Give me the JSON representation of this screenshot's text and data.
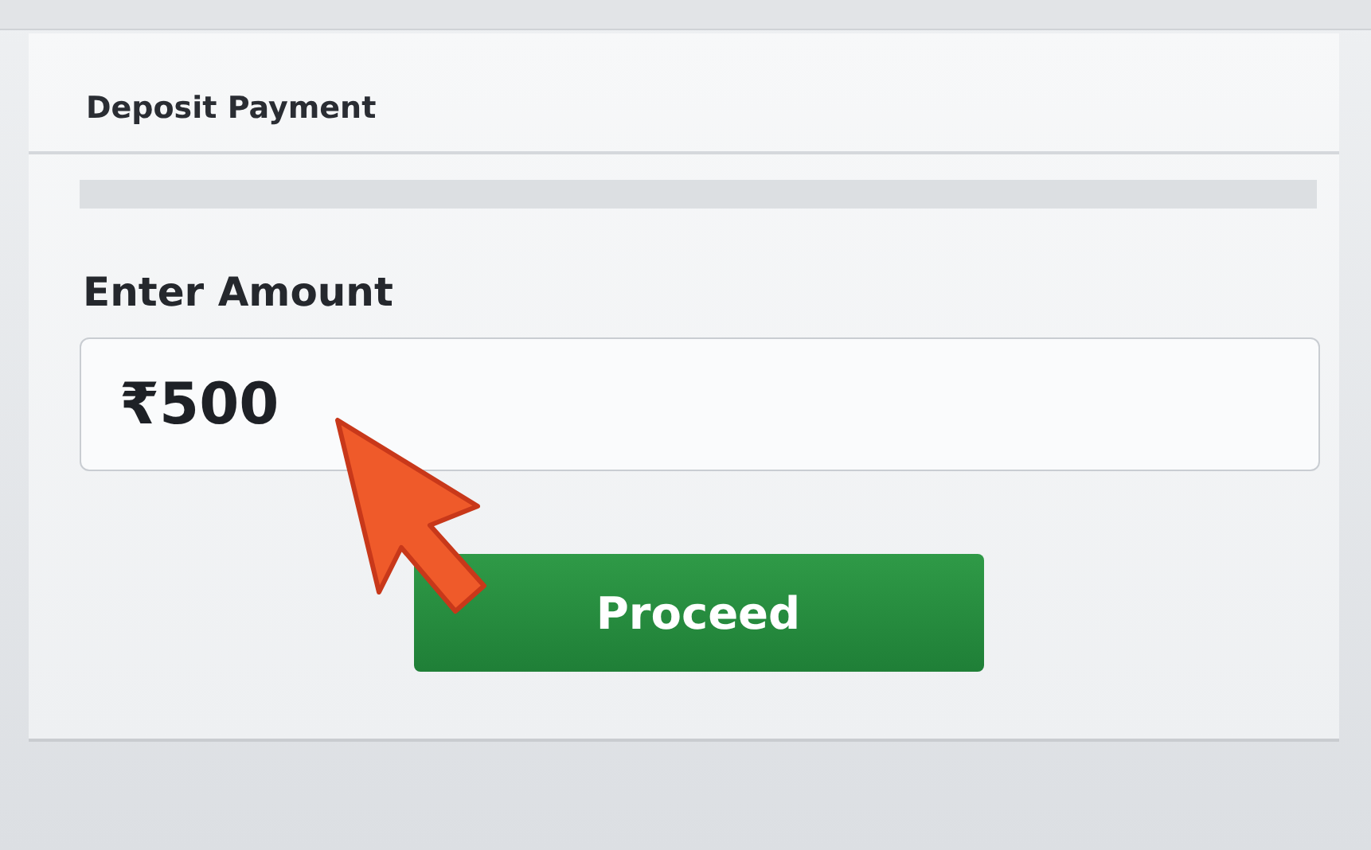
{
  "card": {
    "title": "Deposit Payment"
  },
  "amount": {
    "label": "Enter Amount",
    "value": "₹500"
  },
  "button": {
    "label": "Proceed"
  }
}
